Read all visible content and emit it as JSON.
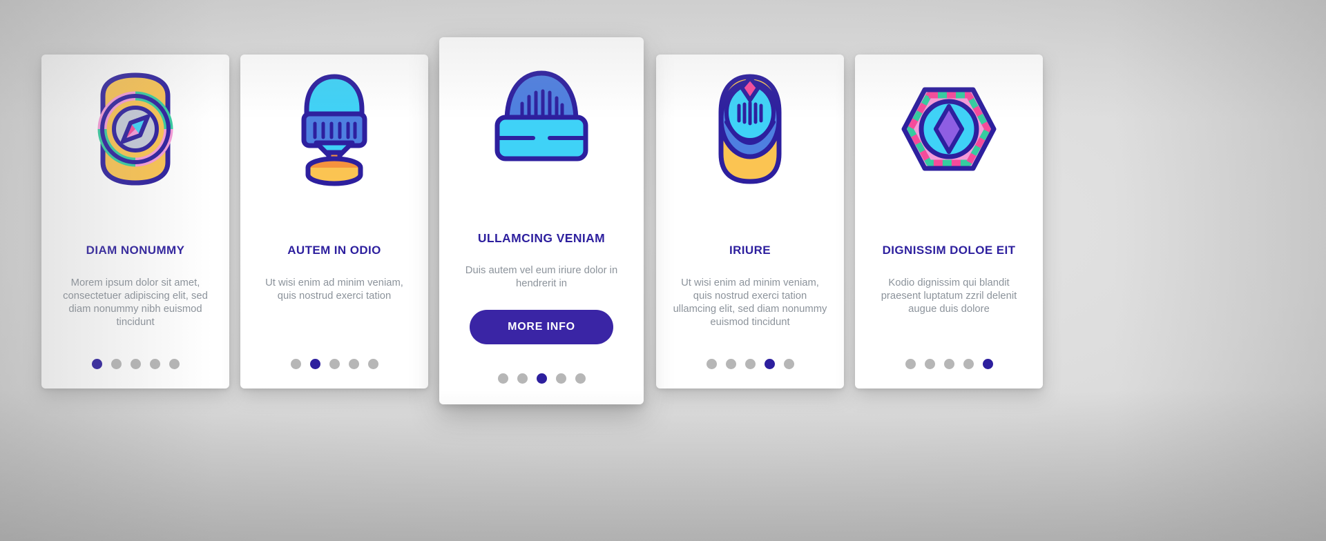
{
  "meta": {
    "background_color": "#d6d6d6",
    "card_background": "#ffffff",
    "accent_color": "#2d1f9e",
    "button_color": "#3a25a5",
    "body_text_color": "#8c939b",
    "dot_inactive_color": "#b6b6b6"
  },
  "cards": [
    {
      "id": "card-1",
      "icon_name": "smart-watch-compass-icon",
      "title": "DIAM NONUMMY",
      "body": "Morem ipsum dolor sit amet, consectetuer adipiscing elit, sed diam nonummy nibh euismod tincidunt",
      "dots": 5,
      "active_dot": 1,
      "featured": false,
      "button_label": null
    },
    {
      "id": "card-2",
      "icon_name": "vr-headset-stand-icon",
      "title": "AUTEM IN ODIO",
      "body": "Ut wisi enim ad minim veniam, quis nostrud exerci tation",
      "dots": 5,
      "active_dot": 2,
      "featured": false,
      "button_label": null
    },
    {
      "id": "card-3",
      "icon_name": "beanie-hat-icon",
      "title": "ULLAMCING VENIAM",
      "body": "Duis autem vel eum iriure dolor in hendrerit in",
      "dots": 5,
      "active_dot": 3,
      "featured": true,
      "button_label": "MORE INFO"
    },
    {
      "id": "card-4",
      "icon_name": "wearable-sensor-icon",
      "title": "IRIURE",
      "body": "Ut wisi enim ad minim veniam, quis nostrud exerci tation ullamcing elit, sed diam nonummy euismod tincidunt",
      "dots": 5,
      "active_dot": 4,
      "featured": false,
      "button_label": null
    },
    {
      "id": "card-5",
      "icon_name": "gem-ring-icon",
      "title": "DIGNISSIM DOLOE EIT",
      "body": "Kodio dignissim qui blandit praesent luptatum zzril delenit augue duis dolore",
      "dots": 5,
      "active_dot": 5,
      "featured": false,
      "button_label": null
    }
  ],
  "palette": {
    "outline": "#2d1f9e",
    "yellow": "#fbc452",
    "cyan": "#3fd2f7",
    "blue": "#4e7fe0",
    "pink": "#f59bd9",
    "magenta": "#f54b9b",
    "green": "#35ccA0",
    "grey_blue": "#c5cbd9",
    "orange": "#f5923e"
  }
}
